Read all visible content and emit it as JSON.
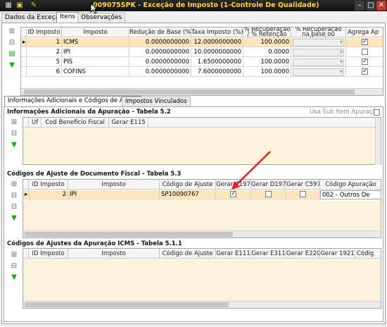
{
  "window": {
    "title": "009075SPK - Exceção de Imposto (1-Controle De Qualidade)"
  },
  "tabs": [
    {
      "label": "Dados da Exceção",
      "active": false
    },
    {
      "label": "Itens",
      "active": true
    },
    {
      "label": "Observações",
      "active": false
    }
  ],
  "impostos_grid": {
    "headers": [
      "ID Imposto",
      "Imposto",
      "Redução de Base (%)",
      "Taxa Imposto (%)",
      "% Recuperação / % Retenção",
      "% Recuperação na base ou alíquota",
      "Agrega Ap"
    ],
    "rows": [
      {
        "id": "1",
        "imposto": "ICMS",
        "reducao": "0.0000000000",
        "taxa": "12.0000000000",
        "recuperacao": "100.0000",
        "agrega": true,
        "selected": true
      },
      {
        "id": "2",
        "imposto": "IPI",
        "reducao": "0.0000000000",
        "taxa": "10.0000000000",
        "recuperacao": "0.0000",
        "agrega": false,
        "selected": false
      },
      {
        "id": "5",
        "imposto": "PIS",
        "reducao": "0.0000000000",
        "taxa": "1.6500000000",
        "recuperacao": "100.0000",
        "agrega": true,
        "selected": false
      },
      {
        "id": "6",
        "imposto": "COFINS",
        "reducao": "0.0000000000",
        "taxa": "7.6000000000",
        "recuperacao": "100.0000",
        "agrega": true,
        "selected": false
      }
    ]
  },
  "subtabs": [
    {
      "label": "Informações Adicionais e Códigos de Ajuste",
      "active": true
    },
    {
      "label": "Impostos Vinculados",
      "active": false
    }
  ],
  "info_adicionais": {
    "title": "Informações Adicionais da Apuração - Tabela 5.2",
    "use_sub_item_label": "Usa Sub Item Apuração",
    "headers": [
      "Uf",
      "Cod Beneficio Fiscal",
      "Gerar E115"
    ]
  },
  "codigos_ajuste_doc": {
    "title": "Códigos de Ajuste de Documento Fiscal - Tabela 5.3",
    "headers": [
      "ID Imposto",
      "Imposto",
      "Código de Ajuste",
      "Gerar C197",
      "Gerar D197",
      "Gerar C597",
      "Código Apuração"
    ],
    "rows": [
      {
        "id": "2",
        "imposto": "IPI",
        "codigo": "SP10090767",
        "c197": true,
        "d197": false,
        "c597": false,
        "apuracao": "002 - Outros De"
      }
    ]
  },
  "codigos_ajuste_icms": {
    "title": "Códigos de Ajustes da Apuração ICMS - Tabela 5.1.1",
    "headers": [
      "ID Imposto",
      "Imposto",
      "Código de Ajuste",
      "Gerar E111",
      "Gerar E311",
      "Gerar E220",
      "Gerar 1921",
      "Códig"
    ]
  },
  "colors": {
    "title_text": "#ffd43b",
    "selected_row": "#fde5b8",
    "annotation_arrow": "#e02020"
  }
}
